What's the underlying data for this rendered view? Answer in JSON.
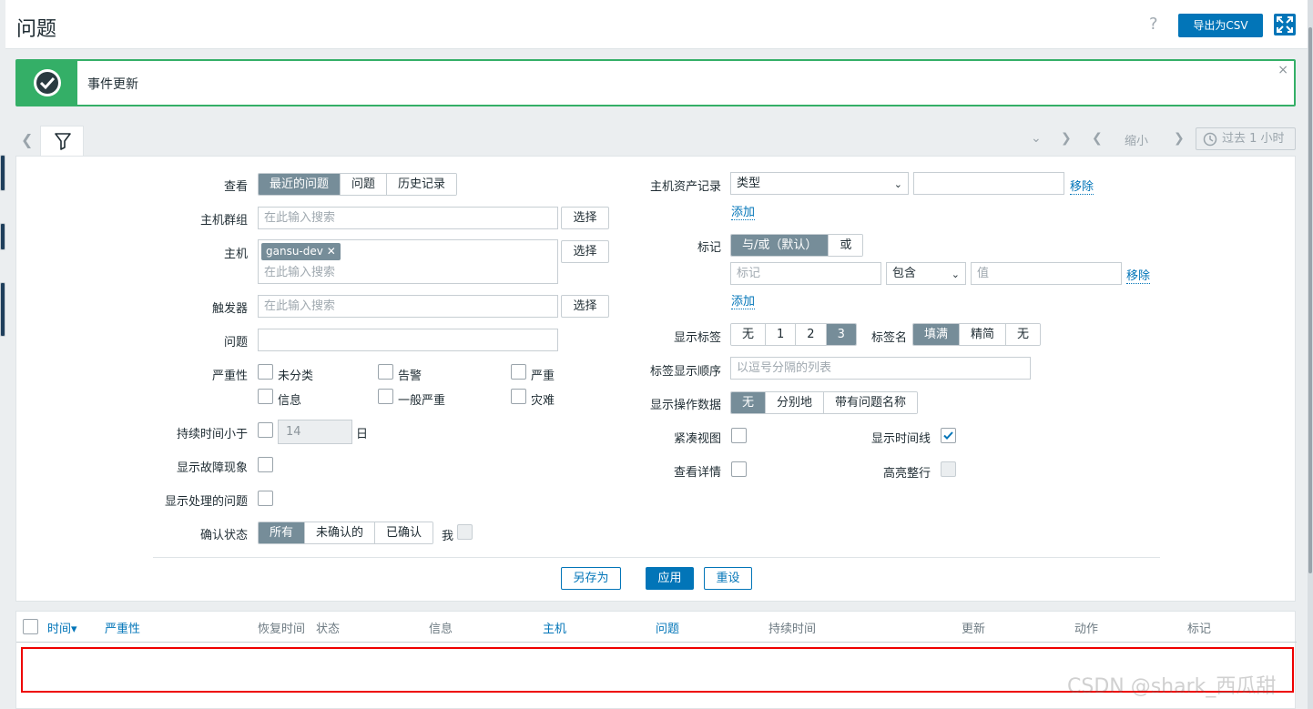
{
  "header": {
    "title": "问题",
    "help": "?",
    "export_label": "导出为CSV"
  },
  "message": {
    "text": "事件更新",
    "close": "×"
  },
  "timebar": {
    "zoom_out": "缩小",
    "period": "过去 1 小时"
  },
  "filter": {
    "show": {
      "label": "查看",
      "options": [
        "最近的问题",
        "问题",
        "历史记录"
      ],
      "selected": 0
    },
    "host_groups": {
      "label": "主机群组",
      "placeholder": "在此输入搜索",
      "select": "选择"
    },
    "hosts": {
      "label": "主机",
      "chip": "gansu-dev",
      "placeholder": "在此输入搜索",
      "select": "选择"
    },
    "triggers": {
      "label": "触发器",
      "placeholder": "在此输入搜索",
      "select": "选择"
    },
    "problem": {
      "label": "问题",
      "value": ""
    },
    "severity": {
      "label": "严重性",
      "options": [
        "未分类",
        "告警",
        "严重",
        "信息",
        "一般严重",
        "灾难"
      ]
    },
    "age": {
      "label": "持续时间小于",
      "value": "14",
      "unit": "日"
    },
    "show_symptoms": {
      "label": "显示故障现象"
    },
    "show_suppressed": {
      "label": "显示处理的问题"
    },
    "ack_status": {
      "label": "确认状态",
      "options": [
        "所有",
        "未确认的",
        "已确认"
      ],
      "selected": 0,
      "me_label": "我"
    },
    "inventory": {
      "label": "主机资产记录",
      "field": "类型",
      "value": "",
      "remove": "移除",
      "add": "添加"
    },
    "tags": {
      "label": "标记",
      "options": [
        "与/或（默认）",
        "或"
      ],
      "selected": 0,
      "tag_placeholder": "标记",
      "operator": "包含",
      "value_placeholder": "值",
      "remove": "移除",
      "add": "添加"
    },
    "show_tags": {
      "label": "显示标签",
      "options": [
        "无",
        "1",
        "2",
        "3"
      ],
      "selected": 3
    },
    "tag_name": {
      "label": "标签名",
      "options": [
        "填满",
        "精简",
        "无"
      ],
      "selected": 0
    },
    "tag_priority": {
      "label": "标签显示顺序",
      "placeholder": "以逗号分隔的列表"
    },
    "show_opdata": {
      "label": "显示操作数据",
      "options": [
        "无",
        "分别地",
        "带有问题名称"
      ],
      "selected": 0
    },
    "compact_view": {
      "label": "紧凑视图",
      "checked": false
    },
    "show_timeline": {
      "label": "显示时间线",
      "checked": true
    },
    "details": {
      "label": "查看详情",
      "checked": false
    },
    "highlight_row": {
      "label": "高亮整行",
      "checked": false
    },
    "buttons": {
      "save_as": "另存为",
      "apply": "应用",
      "reset": "重设"
    }
  },
  "table": {
    "columns": [
      "时间",
      "严重性",
      "恢复时间",
      "状态",
      "信息",
      "主机",
      "问题",
      "持续时间",
      "更新",
      "动作",
      "标记"
    ],
    "sort_indicator": "▾"
  },
  "watermark": "CSDN @shark_西瓜甜",
  "colors": {
    "accent": "#0275b8",
    "success": "#34af67",
    "segment_on": "#768d99",
    "highlight": "#ee0000"
  }
}
